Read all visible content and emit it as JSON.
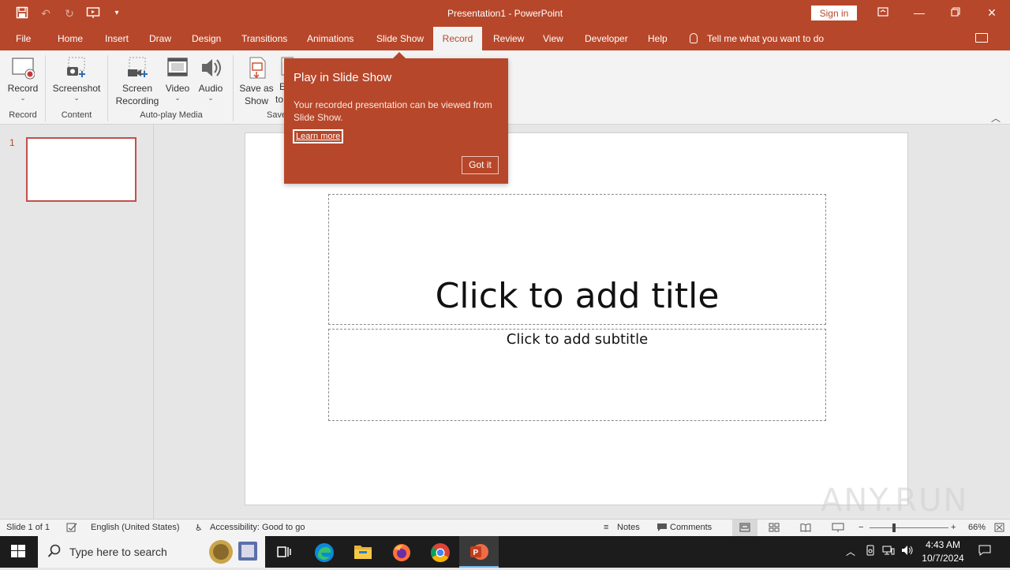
{
  "app": {
    "window_title": "Presentation1  -  PowerPoint",
    "sign_in_label": "Sign in"
  },
  "tabs": [
    "File",
    "Home",
    "Insert",
    "Draw",
    "Design",
    "Transitions",
    "Animations",
    "Slide Show",
    "Record",
    "Review",
    "View",
    "Developer",
    "Help"
  ],
  "active_tab": "Record",
  "tell_me": "Tell me what you want to do",
  "ribbon": {
    "record": {
      "label": "Record",
      "group": "Record"
    },
    "screenshot": {
      "label": "Screenshot",
      "group": "Content"
    },
    "screen_recording": {
      "line1": "Screen",
      "line2": "Recording"
    },
    "video": {
      "label": "Video"
    },
    "audio": {
      "label": "Audio"
    },
    "autoplay_group": "Auto-play Media",
    "save_as_show": {
      "line1": "Save as",
      "line2": "Show"
    },
    "export_partial": {
      "line1": "E",
      "line2": "to"
    },
    "save_group_partial": "Save"
  },
  "thumbnail": {
    "number": "1"
  },
  "slide": {
    "title_placeholder": "Click to add title",
    "subtitle_placeholder": "Click to add subtitle"
  },
  "popup": {
    "title": "Play in Slide Show",
    "body": "Your recorded presentation can be viewed from Slide Show.",
    "learn_more": "Learn more",
    "got_it": "Got it"
  },
  "status": {
    "slide_count": "Slide 1 of 1",
    "language": "English (United States)",
    "accessibility": "Accessibility: Good to go",
    "notes": "Notes",
    "comments": "Comments",
    "zoom": "66%"
  },
  "taskbar": {
    "search_placeholder": "Type here to search",
    "time": "4:43 AM",
    "date": "10/7/2024"
  },
  "watermark": "ANY.RUN",
  "colors": {
    "accent": "#b7472a",
    "ribbon_bg": "#f3f3f3",
    "workspace_bg": "#e6e6e6",
    "taskbar_bg": "#1c1c1c"
  }
}
